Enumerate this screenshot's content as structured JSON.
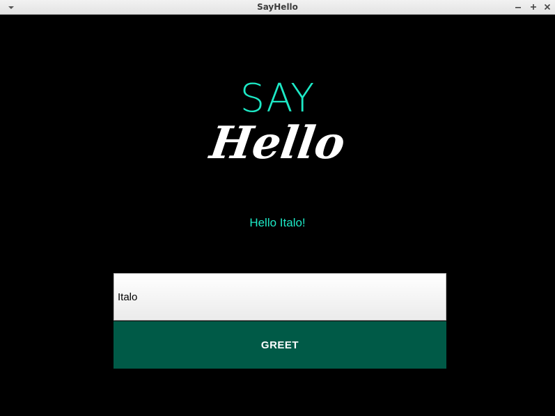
{
  "window": {
    "title": "SayHello",
    "controls": {
      "menu_icon": "chevron-down-icon",
      "minimize_icon": "minimize-icon",
      "maximize_icon": "maximize-icon",
      "close_icon": "close-icon"
    }
  },
  "logo": {
    "say": "SAY",
    "hello": "Hello"
  },
  "greeting": "Hello Italo!",
  "form": {
    "name_value": "Italo",
    "greet_label": "GREET"
  },
  "colors": {
    "accent": "#1de9c6",
    "button": "#005a47",
    "background": "#000000"
  }
}
